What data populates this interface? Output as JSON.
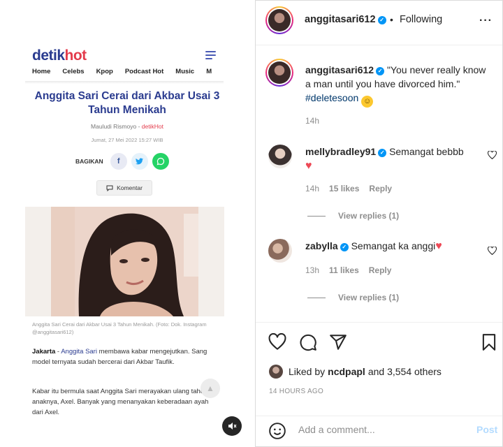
{
  "article": {
    "logo_a": "detik",
    "logo_b": "hot",
    "nav": [
      "Home",
      "Celebs",
      "Kpop",
      "Podcast Hot",
      "Music",
      "M"
    ],
    "title": "Anggita Sari Cerai dari Akbar Usai 3 Tahun Menikah",
    "author": "Mauludi Rismoyo",
    "source": "detikHot",
    "date": "Jumat, 27 Mei 2022 15:27 WIB",
    "share_label": "BAGIKAN",
    "komentar_label": "Komentar",
    "photo_caption": "Anggita Sari Cerai dari Akbar Usai 3 Tahun Menikah. (Foto: Dok. Instagram @anggitasari612)",
    "p1_lead": "Jakarta",
    "p1_link": "Anggita Sari",
    "p1_rest": "membawa kabar mengejutkan. Sang model ternyata sudah bercerai dari Akbar Taufik.",
    "p2": "Kabar itu bermula saat Anggita Sari merayakan ulang tahun anaknya, Axel. Banyak yang menanyakan keberadaan ayah dari Axel."
  },
  "post": {
    "username": "anggitasari612",
    "separator": "•",
    "follow_status": "Following",
    "caption_text": "\"You never really know a man until you have divorced him.\"",
    "hashtag": "#deletesoon",
    "caption_time": "14h",
    "likes_prefix": "Liked by",
    "likes_user": "ncdpapl",
    "likes_suffix": "and 3,554 others",
    "time_ago": "14 HOURS AGO",
    "add_comment_placeholder": "Add a comment...",
    "post_label": "Post"
  },
  "comments": [
    {
      "username": "mellybradley91",
      "text": "Semangat bebbb",
      "time": "14h",
      "likes": "15 likes",
      "reply_label": "Reply",
      "view_replies": "View replies (1)"
    },
    {
      "username": "zabylla",
      "text": "Semangat ka anggi",
      "time": "13h",
      "likes": "11 likes",
      "reply_label": "Reply",
      "view_replies": "View replies (1)"
    }
  ],
  "colors": {
    "detik_blue": "#2a3b8f",
    "detik_red": "#e33b4b",
    "ig_blue": "#0095f6",
    "heart_red": "#ed4956"
  },
  "icons": [
    "heart-icon",
    "comment-icon",
    "share-icon",
    "bookmark-icon",
    "emoji-icon",
    "more-icon",
    "verified-badge-icon"
  ]
}
